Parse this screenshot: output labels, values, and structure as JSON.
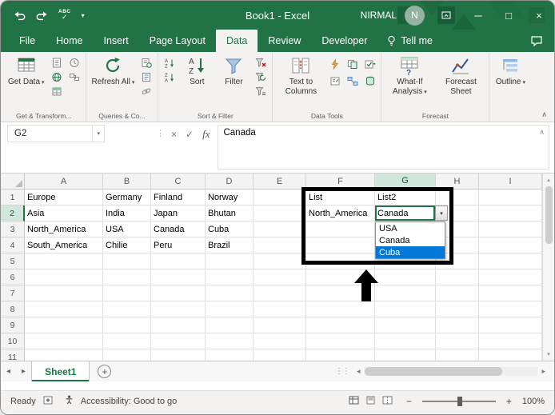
{
  "window": {
    "title": "Book1  -  Excel",
    "user_name": "NIRMAL",
    "avatar_initial": "N"
  },
  "quick_access": {
    "spelling": "ABC"
  },
  "ribbon_tabs": {
    "items": [
      "File",
      "Home",
      "Insert",
      "Page Layout",
      "Data",
      "Review",
      "Developer"
    ],
    "active": "Data",
    "tell_me": "Tell me"
  },
  "ribbon": {
    "get_data_label": "Get Data",
    "refresh_all_label": "Refresh All",
    "sort_label": "Sort",
    "filter_label": "Filter",
    "text_to_columns_label": "Text to Columns",
    "what_if_label": "What-If Analysis",
    "forecast_sheet_label": "Forecast Sheet",
    "outline_label": "Outline",
    "group_labels": [
      "Get & Transform...",
      "Queries & Co...",
      "Sort & Filter",
      "Data Tools",
      "Forecast"
    ]
  },
  "formula_bar": {
    "name_box": "G2",
    "fx_label": "fx",
    "content": "Canada"
  },
  "grid": {
    "columns": [
      "A",
      "B",
      "C",
      "D",
      "E",
      "F",
      "G",
      "H",
      "I"
    ],
    "row_numbers": [
      "1",
      "2",
      "3",
      "4",
      "5",
      "6",
      "7",
      "8",
      "9",
      "10",
      "11"
    ],
    "cell_rows": [
      [
        "Europe",
        "Germany",
        "Finland",
        "Norway",
        "",
        "List",
        "List2",
        "",
        ""
      ],
      [
        "Asia",
        "India",
        "Japan",
        "Bhutan",
        "",
        "North_America",
        "Canada",
        "",
        ""
      ],
      [
        "North_America",
        "USA",
        "Canada",
        "Cuba",
        "",
        "",
        "",
        "",
        ""
      ],
      [
        "South_America",
        "Chilie",
        "Peru",
        "Brazil",
        "",
        "",
        "",
        "",
        ""
      ],
      [
        "",
        "",
        "",
        "",
        "",
        "",
        "",
        "",
        ""
      ],
      [
        "",
        "",
        "",
        "",
        "",
        "",
        "",
        "",
        ""
      ],
      [
        "",
        "",
        "",
        "",
        "",
        "",
        "",
        "",
        ""
      ],
      [
        "",
        "",
        "",
        "",
        "",
        "",
        "",
        "",
        ""
      ],
      [
        "",
        "",
        "",
        "",
        "",
        "",
        "",
        "",
        ""
      ],
      [
        "",
        "",
        "",
        "",
        "",
        "",
        "",
        "",
        ""
      ],
      [
        "",
        "",
        "",
        "",
        "",
        "",
        "",
        "",
        ""
      ]
    ],
    "selected_column": "G",
    "selected_row": "2",
    "dropdown_options": [
      "USA",
      "Canada",
      "Cuba"
    ],
    "dropdown_highlighted": "Cuba"
  },
  "sheet_tabs": {
    "active_tab": "Sheet1"
  },
  "status_bar": {
    "mode": "Ready",
    "accessibility": "Accessibility: Good to go",
    "zoom_level": "100%"
  },
  "colors": {
    "excel_green": "#217346",
    "selection_blue": "#0078d7"
  }
}
